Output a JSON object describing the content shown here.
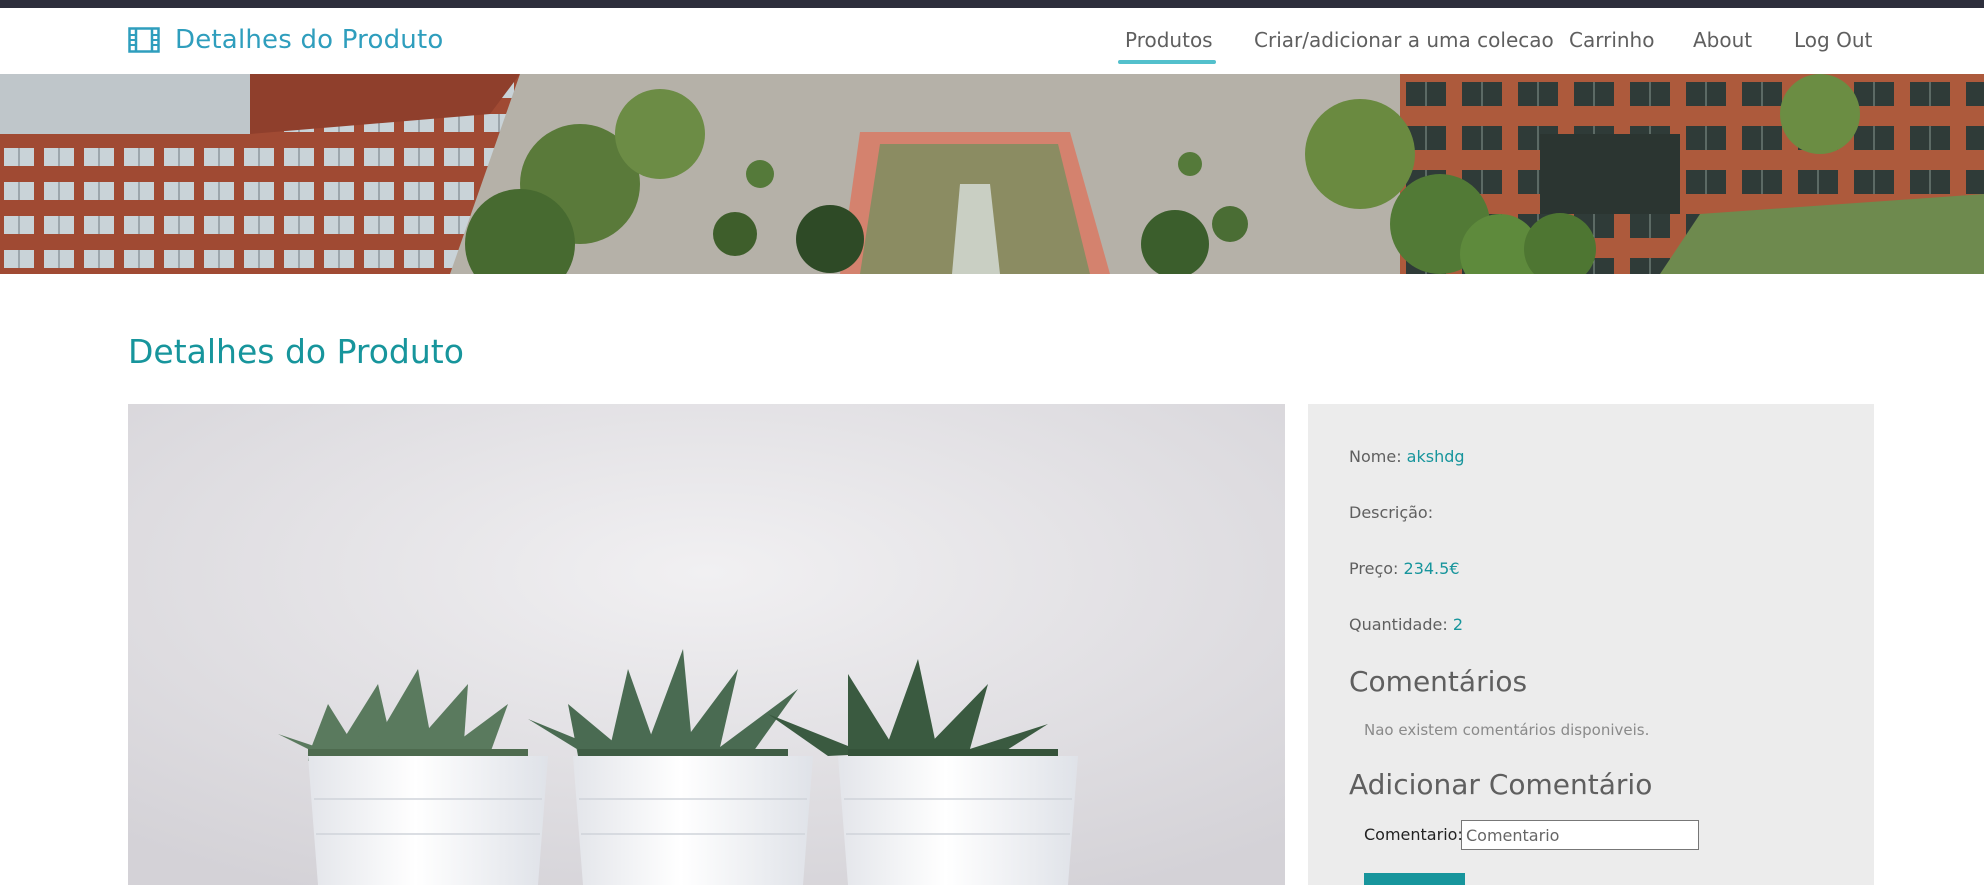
{
  "header": {
    "brand_icon": "film-icon",
    "brand_title": "Detalhes do Produto",
    "nav": [
      {
        "label": "Produtos",
        "active": true
      },
      {
        "label": "Criar/adicionar a uma colecao",
        "active": false
      },
      {
        "label": "Carrinho",
        "active": false
      },
      {
        "label": "About",
        "active": false
      },
      {
        "label": "Log Out",
        "active": false
      }
    ]
  },
  "page": {
    "title": "Detalhes do Produto"
  },
  "product": {
    "name_label": "Nome:",
    "name": "akshdg",
    "description_label": "Descrição:",
    "description": "",
    "price_label": "Preço:",
    "price": "234.5€",
    "quantity_label": "Quantidade:",
    "quantity": "2"
  },
  "comments": {
    "heading": "Comentários",
    "empty_text": "Nao existem comentários disponiveis.",
    "add_heading": "Adicionar Comentário",
    "input_label": "Comentario:",
    "input_placeholder": "Comentario",
    "input_value": ""
  },
  "colors": {
    "accent": "#17959c",
    "brand": "#2f9ebd",
    "nav_active": "#53c0cc",
    "topstrip": "#2d2e3c",
    "panel_bg": "#ececec"
  }
}
